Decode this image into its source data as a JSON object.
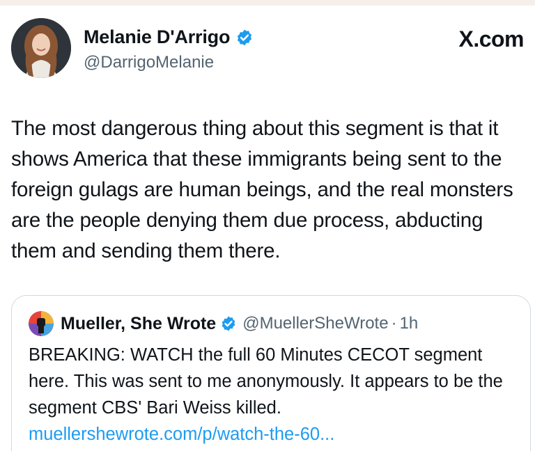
{
  "colors": {
    "text": "#0f1419",
    "secondary": "#536471",
    "link": "#1d9bf0",
    "verified_badge": "#1d9bf0",
    "card_border": "#cfd9de"
  },
  "author": {
    "display_name": "Melanie D'Arrigo",
    "handle": "@DarrigoMelanie",
    "avatar_icon": "profile-photo",
    "verified_icon": "verified-badge-icon"
  },
  "brand": {
    "label": "X.com"
  },
  "tweet": {
    "text": "The most dangerous thing about this segment is that it shows America that these immigrants being sent to the foreign gulags are human beings, and the real monsters are the people denying them due process, abducting them and sending them there."
  },
  "quoted_tweet": {
    "display_name": "Mueller, She Wrote",
    "handle": "@MuellerSheWrote",
    "separator": "·",
    "time": "1h",
    "body": "BREAKING: WATCH the full 60 Minutes CECOT segment here. This was sent to me anonymously. It appears to be the segment CBS' Bari Weiss killed.",
    "link": "muellershewrote.com/p/watch-the-60..."
  }
}
